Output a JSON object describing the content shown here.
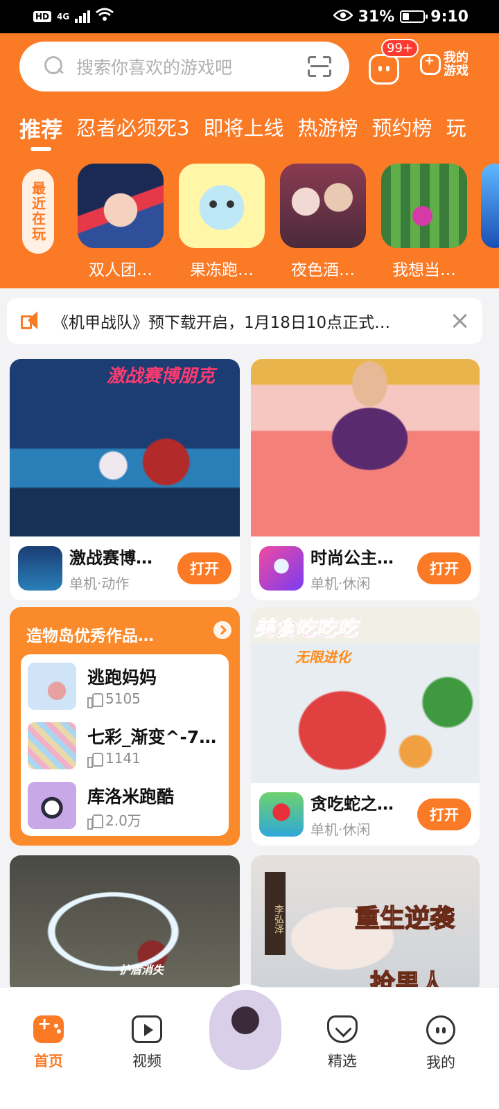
{
  "status_bar": {
    "hd": "HD",
    "network": "4G",
    "battery_percent": "31%",
    "battery_level": 0.31,
    "time": "9:10"
  },
  "header": {
    "search_placeholder": "搜索你喜欢的游戏吧",
    "message_badge": "99+",
    "my_games_label": "我的游戏"
  },
  "tabs": [
    {
      "label": "推荐",
      "active": true
    },
    {
      "label": "忍者必须死3"
    },
    {
      "label": "即将上线"
    },
    {
      "label": "热游榜"
    },
    {
      "label": "预约榜"
    },
    {
      "label": "玩"
    }
  ],
  "recent": {
    "label": "最近在玩",
    "items": [
      {
        "name": "双人团…"
      },
      {
        "name": "果冻跑…"
      },
      {
        "name": "夜色酒…"
      },
      {
        "name": "我想当…"
      }
    ]
  },
  "notice": {
    "text": "《机甲战队》预下载开启，1月18日10点正式…"
  },
  "cards": [
    {
      "banner_caption": "激战赛博朋克",
      "title": "激战赛博…",
      "sub": "单机·动作",
      "button": "打开"
    },
    {
      "banner_caption": "",
      "title": "时尚公主…",
      "sub": "单机·休闲",
      "button": "打开"
    },
    {
      "banner_caption": "美食吃吃吃",
      "banner_caption2": "无限进化",
      "title": "贪吃蛇之…",
      "sub": "单机·休闲",
      "button": "打开"
    },
    {
      "banner_caption": "护盾消失"
    },
    {
      "banner_caption": "重生逆袭",
      "banner_caption2": "抢男人",
      "banner_tag": "李弘泽"
    }
  ],
  "creation": {
    "title": "造物岛优秀作品…",
    "items": [
      {
        "name": "逃跑妈妈",
        "likes": "5105"
      },
      {
        "name": "七彩_渐变^-7…",
        "likes": "1141"
      },
      {
        "name": "库洛米跑酷",
        "likes": "2.0万"
      }
    ]
  },
  "bottom_nav": [
    {
      "label": "首页",
      "active": true
    },
    {
      "label": "视频"
    },
    {
      "label": "精选"
    },
    {
      "label": "我的"
    }
  ],
  "colors": {
    "accent": "#fa7a26",
    "badge": "#ff3b30"
  }
}
